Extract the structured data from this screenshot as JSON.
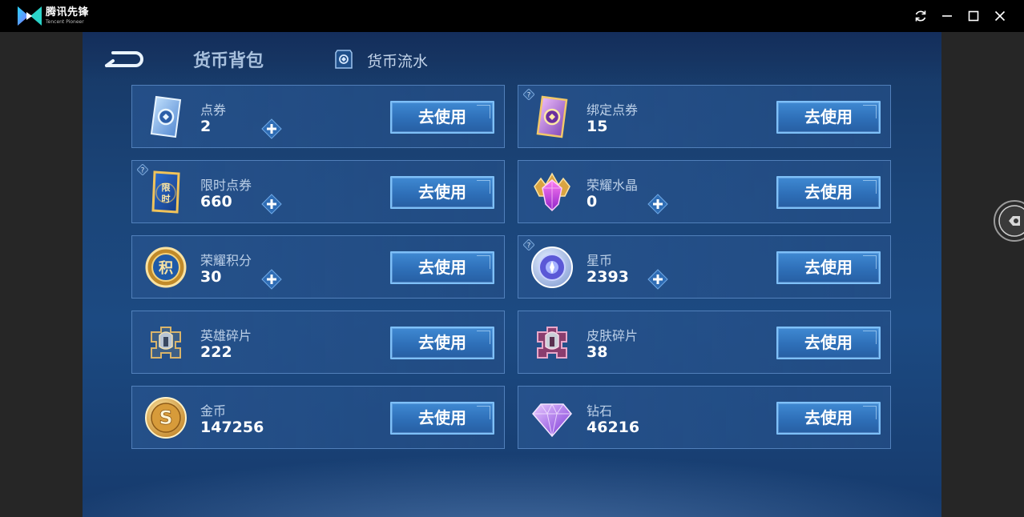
{
  "app": {
    "name": "腾讯先锋",
    "subtitle": "Tencent Pioneer"
  },
  "header": {
    "title": "货币背包",
    "ledger_label": "货币流水"
  },
  "currencies": [
    {
      "name": "点券",
      "amount": "2",
      "use_label": "去使用",
      "has_plus": true,
      "has_help": false,
      "icon": "coupon-card-icon"
    },
    {
      "name": "绑定点券",
      "amount": "15",
      "use_label": "去使用",
      "has_plus": false,
      "has_help": true,
      "icon": "bound-coupon-card-icon"
    },
    {
      "name": "限时点券",
      "amount": "660",
      "use_label": "去使用",
      "has_plus": true,
      "has_help": true,
      "icon": "limited-coupon-icon"
    },
    {
      "name": "荣耀水晶",
      "amount": "0",
      "use_label": "去使用",
      "has_plus": true,
      "has_help": false,
      "icon": "glory-crystal-icon"
    },
    {
      "name": "荣耀积分",
      "amount": "30",
      "use_label": "去使用",
      "has_plus": true,
      "has_help": false,
      "icon": "glory-points-icon"
    },
    {
      "name": "星币",
      "amount": "2393",
      "use_label": "去使用",
      "has_plus": true,
      "has_help": true,
      "icon": "star-coin-icon"
    },
    {
      "name": "英雄碎片",
      "amount": "222",
      "use_label": "去使用",
      "has_plus": false,
      "has_help": false,
      "icon": "hero-fragment-icon"
    },
    {
      "name": "皮肤碎片",
      "amount": "38",
      "use_label": "去使用",
      "has_plus": false,
      "has_help": false,
      "icon": "skin-fragment-icon"
    },
    {
      "name": "金币",
      "amount": "147256",
      "use_label": "去使用",
      "has_plus": false,
      "has_help": false,
      "icon": "gold-coin-icon"
    },
    {
      "name": "钻石",
      "amount": "46216",
      "use_label": "去使用",
      "has_plus": false,
      "has_help": false,
      "icon": "diamond-icon"
    }
  ],
  "colors": {
    "titlebar": "#000000",
    "panel": "#1c4a82",
    "button": "#2e6fb8",
    "button_border": "#7ec0f8"
  }
}
